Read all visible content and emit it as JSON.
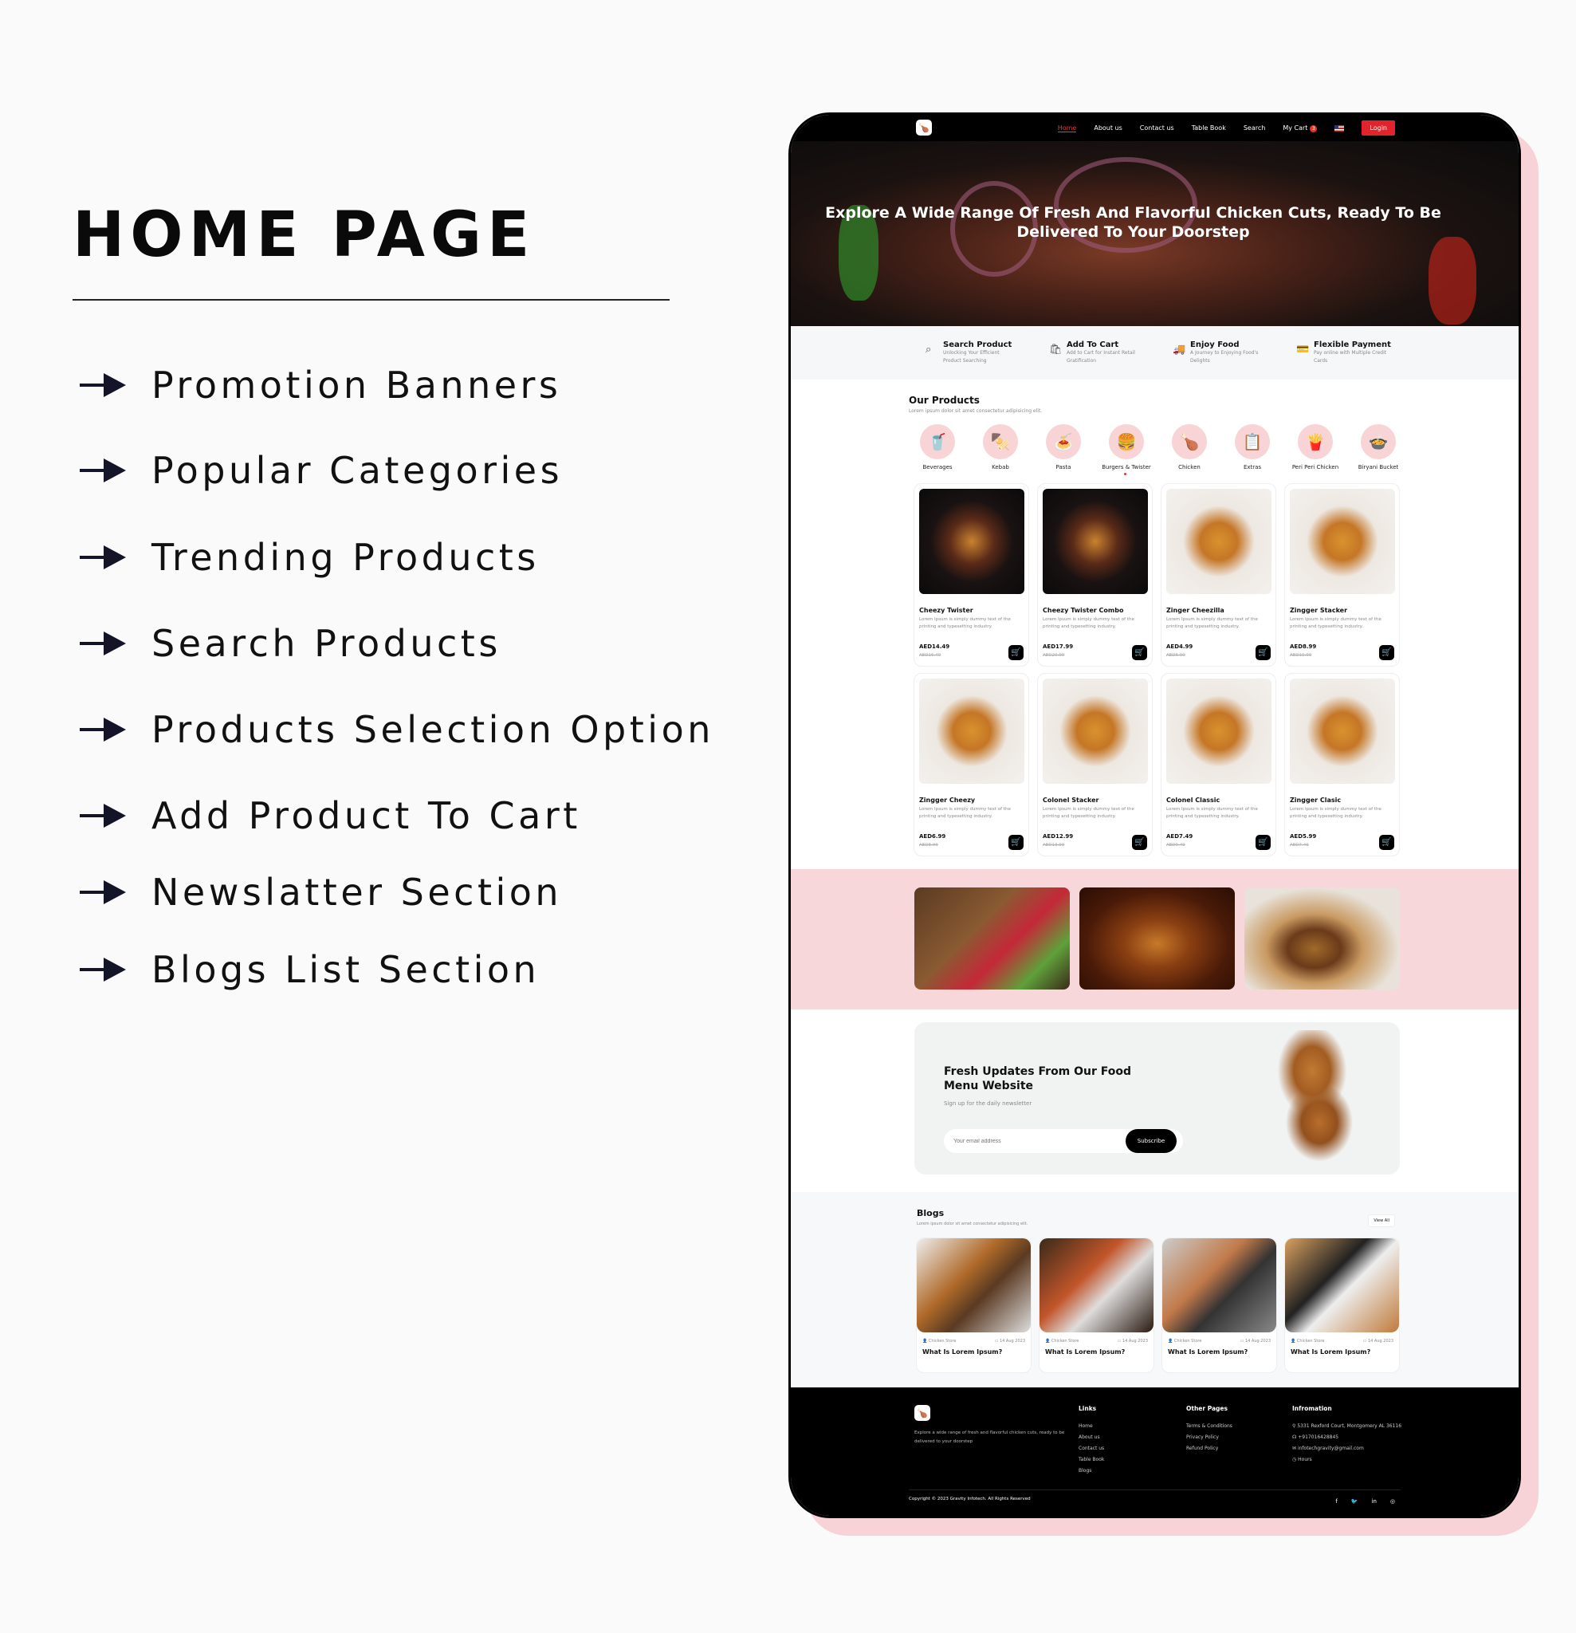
{
  "heading": "HOME PAGE",
  "features": [
    "Promotion Banners",
    "Popular Categories",
    "Trending Products",
    "Search Products",
    "Products Selection Option",
    "Add Product To Cart",
    "Newslatter Section",
    "Blogs List Section"
  ],
  "colors": {
    "accent": "#e3232b",
    "pink": "#f8d7db",
    "dark": "#000000"
  },
  "site": {
    "nav": {
      "links": [
        "Home",
        "About us",
        "Contact us",
        "Table Book",
        "Search",
        "My Cart"
      ],
      "cart_count": "3",
      "login": "Login",
      "flag_icon": "us-flag-icon"
    },
    "hero_title": "Explore A Wide Range Of Fresh And Flavorful Chicken Cuts, Ready To Be Delivered To Your Doorstep",
    "highlights": [
      {
        "icon": "search-icon",
        "title": "Search Product",
        "desc": "Unlocking Your Efficient Product Searching"
      },
      {
        "icon": "shopping-bag-icon",
        "title": "Add To Cart",
        "desc": "Add to Cart for Instant Retail Gratification"
      },
      {
        "icon": "delivery-truck-icon",
        "title": "Enjoy Food",
        "desc": "A Journey to Enjoying Food's Delights"
      },
      {
        "icon": "credit-card-icon",
        "title": "Flexible Payment",
        "desc": "Pay online with Multiple Credit Cards"
      }
    ],
    "products_title": "Our Products",
    "products_sub": "Lorem ipsum dolor sit amet consectetur adipisicing elit.",
    "categories": [
      {
        "label": "Beverages",
        "icon": "🥤"
      },
      {
        "label": "Kebab",
        "icon": "🍢"
      },
      {
        "label": "Pasta",
        "icon": "🍝"
      },
      {
        "label": "Burgers & Twister",
        "icon": "🍔"
      },
      {
        "label": "Chicken",
        "icon": "🍗"
      },
      {
        "label": "Extras",
        "icon": "📋"
      },
      {
        "label": "Peri Peri Chicken",
        "icon": "🍟"
      },
      {
        "label": "Biryani Bucket",
        "icon": "🍲"
      }
    ],
    "products": [
      {
        "name": "Cheezy Twister",
        "desc": "Lorem Ipsum is simply dummy text of the printing and typesetting industry.",
        "price": "AED14.49",
        "old": "AED16.49"
      },
      {
        "name": "Cheezy Twister Combo",
        "desc": "Lorem Ipsum is simply dummy text of the printing and typesetting industry.",
        "price": "AED17.99",
        "old": "AED20.99"
      },
      {
        "name": "Zinger Cheezilla",
        "desc": "Lorem Ipsum is simply dummy text of the printing and typesetting industry.",
        "price": "AED4.99",
        "old": "AED6.99"
      },
      {
        "name": "Zingger Stacker",
        "desc": "Lorem Ipsum is simply dummy text of the printing and typesetting industry.",
        "price": "AED8.99",
        "old": "AED10.99"
      },
      {
        "name": "Zingger Cheezy",
        "desc": "Lorem Ipsum is simply dummy text of the printing and typesetting industry.",
        "price": "AED6.99",
        "old": "AED8.99"
      },
      {
        "name": "Colonel Stacker",
        "desc": "Lorem Ipsum is simply dummy text of the printing and typesetting industry.",
        "price": "AED12.99",
        "old": "AED13.99"
      },
      {
        "name": "Colonel Classic",
        "desc": "Lorem Ipsum is simply dummy text of the printing and typesetting industry.",
        "price": "AED7.49",
        "old": "AED9.49"
      },
      {
        "name": "Zingger Clasic",
        "desc": "Lorem Ipsum is simply dummy text of the printing and typesetting industry.",
        "price": "AED5.99",
        "old": "AED7.49"
      }
    ],
    "newsletter": {
      "title": "Fresh Updates From Our Food Menu Website",
      "sub": "Sign up for the daily newsletter",
      "placeholder": "Your email address",
      "button": "Subscribe"
    },
    "blogs": {
      "title": "Blogs",
      "sub": "Lorem ipsum dolor sit amet consectetur adipisicing elit.",
      "view_all": "View All",
      "items": [
        {
          "author": "Chicken Store",
          "date": "14 Aug 2023",
          "title": "What Is Lorem Ipsum?"
        },
        {
          "author": "Chicken Store",
          "date": "14 Aug 2023",
          "title": "What Is Lorem Ipsum?"
        },
        {
          "author": "Chicken Store",
          "date": "14 Aug 2023",
          "title": "What Is Lorem Ipsum?"
        },
        {
          "author": "Chicken Store",
          "date": "14 Aug 2023",
          "title": "What Is Lorem Ipsum?"
        }
      ]
    },
    "footer": {
      "desc": "Explore a wide range of fresh and flavorful chicken cuts, ready to be delivered to your doorstep",
      "links_title": "Links",
      "links": [
        "Home",
        "About us",
        "Contact us",
        "Table Book",
        "Blogs"
      ],
      "other_title": "Other Pages",
      "other": [
        "Terms & Conditions",
        "Privacy Policy",
        "Refund Policy"
      ],
      "info_title": "Infromation",
      "address": "5331 Rexford Court, Montgomery AL 36116",
      "phone": "+917016428845",
      "email": "infotechgravity@gmail.com",
      "hours": "Hours",
      "copyright": "Copyright © 2023 Gravity Infotech. All Rights Reserved",
      "social": [
        "facebook-icon",
        "twitter-icon",
        "linkedin-icon",
        "instagram-icon"
      ]
    }
  }
}
